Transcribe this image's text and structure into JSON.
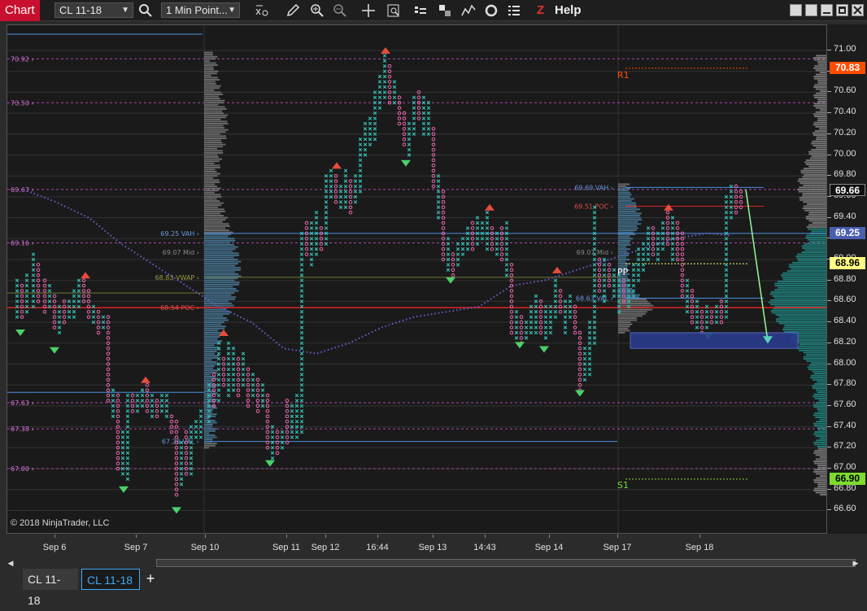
{
  "toolbar": {
    "title": "Chart",
    "instrument": "CL 11-18",
    "interval": "1 Min Point...",
    "help_label": "Help",
    "help_z": "Z",
    "icons": [
      "search-icon",
      "crosshair-xo-icon",
      "pencil-icon",
      "zoom-in-icon",
      "zoom-out-icon",
      "crosshair-icon",
      "properties-icon",
      "bar-type-icon",
      "templates-icon",
      "indicators-icon",
      "strategies-icon",
      "list-icon"
    ]
  },
  "chart": {
    "copyright": "© 2018 NinjaTrader, LLC",
    "pivot_labels": {
      "r1": "R1",
      "pp": "PP",
      "s1": "S1"
    },
    "left_price_labels": [
      "70.92",
      "70.50",
      "69.67",
      "69.16",
      "67.63",
      "67.38",
      "67.00"
    ],
    "profile_labels": [
      "69.25 VAH",
      "69.07 Mid",
      "68.83 VWAP",
      "68.54 POC",
      "67.26 VAL",
      "69.69 VAH",
      "69.51 POC",
      "69.07 Mid",
      "68.63 VAL"
    ],
    "colors": {
      "x_bar": "#34c2b6",
      "o_bar": "#f06ab0",
      "up_triangle": "#e74c3c",
      "down_triangle": "#4cd06a",
      "ma_line": "#6c5fd0",
      "poc_line": "#e02424",
      "va_line": "#5b8fd8"
    }
  },
  "price_axis": {
    "ticks": [
      "71.00",
      "70.80",
      "70.60",
      "70.40",
      "70.20",
      "70.00",
      "69.80",
      "69.60",
      "69.40",
      "69.20",
      "69.00",
      "68.80",
      "68.60",
      "68.40",
      "68.20",
      "68.00",
      "67.80",
      "67.60",
      "67.40",
      "67.20",
      "67.00",
      "66.80",
      "66.60"
    ],
    "badges": [
      {
        "label": "70.83",
        "bg": "#ff4d00",
        "fg": "#ffffff"
      },
      {
        "label": "69.66",
        "bg": "#111111",
        "fg": "#ffffff"
      },
      {
        "label": "69.25",
        "bg": "#4a5fb0",
        "fg": "#ffffff"
      },
      {
        "label": "68.96",
        "bg": "#ffff80",
        "fg": "#000000"
      },
      {
        "label": "66.90",
        "bg": "#7ddc2c",
        "fg": "#000000"
      }
    ]
  },
  "time_axis": {
    "labels": [
      "Sep 6",
      "Sep 7",
      "Sep 10",
      "Sep 11",
      "Sep 12",
      "16:44",
      "Sep 13",
      "14:43",
      "Sep 14",
      "Sep 17",
      "Sep 18"
    ]
  },
  "tabs": {
    "items": [
      "CL 11-18",
      "CL 11-18"
    ],
    "add_label": "+"
  }
}
